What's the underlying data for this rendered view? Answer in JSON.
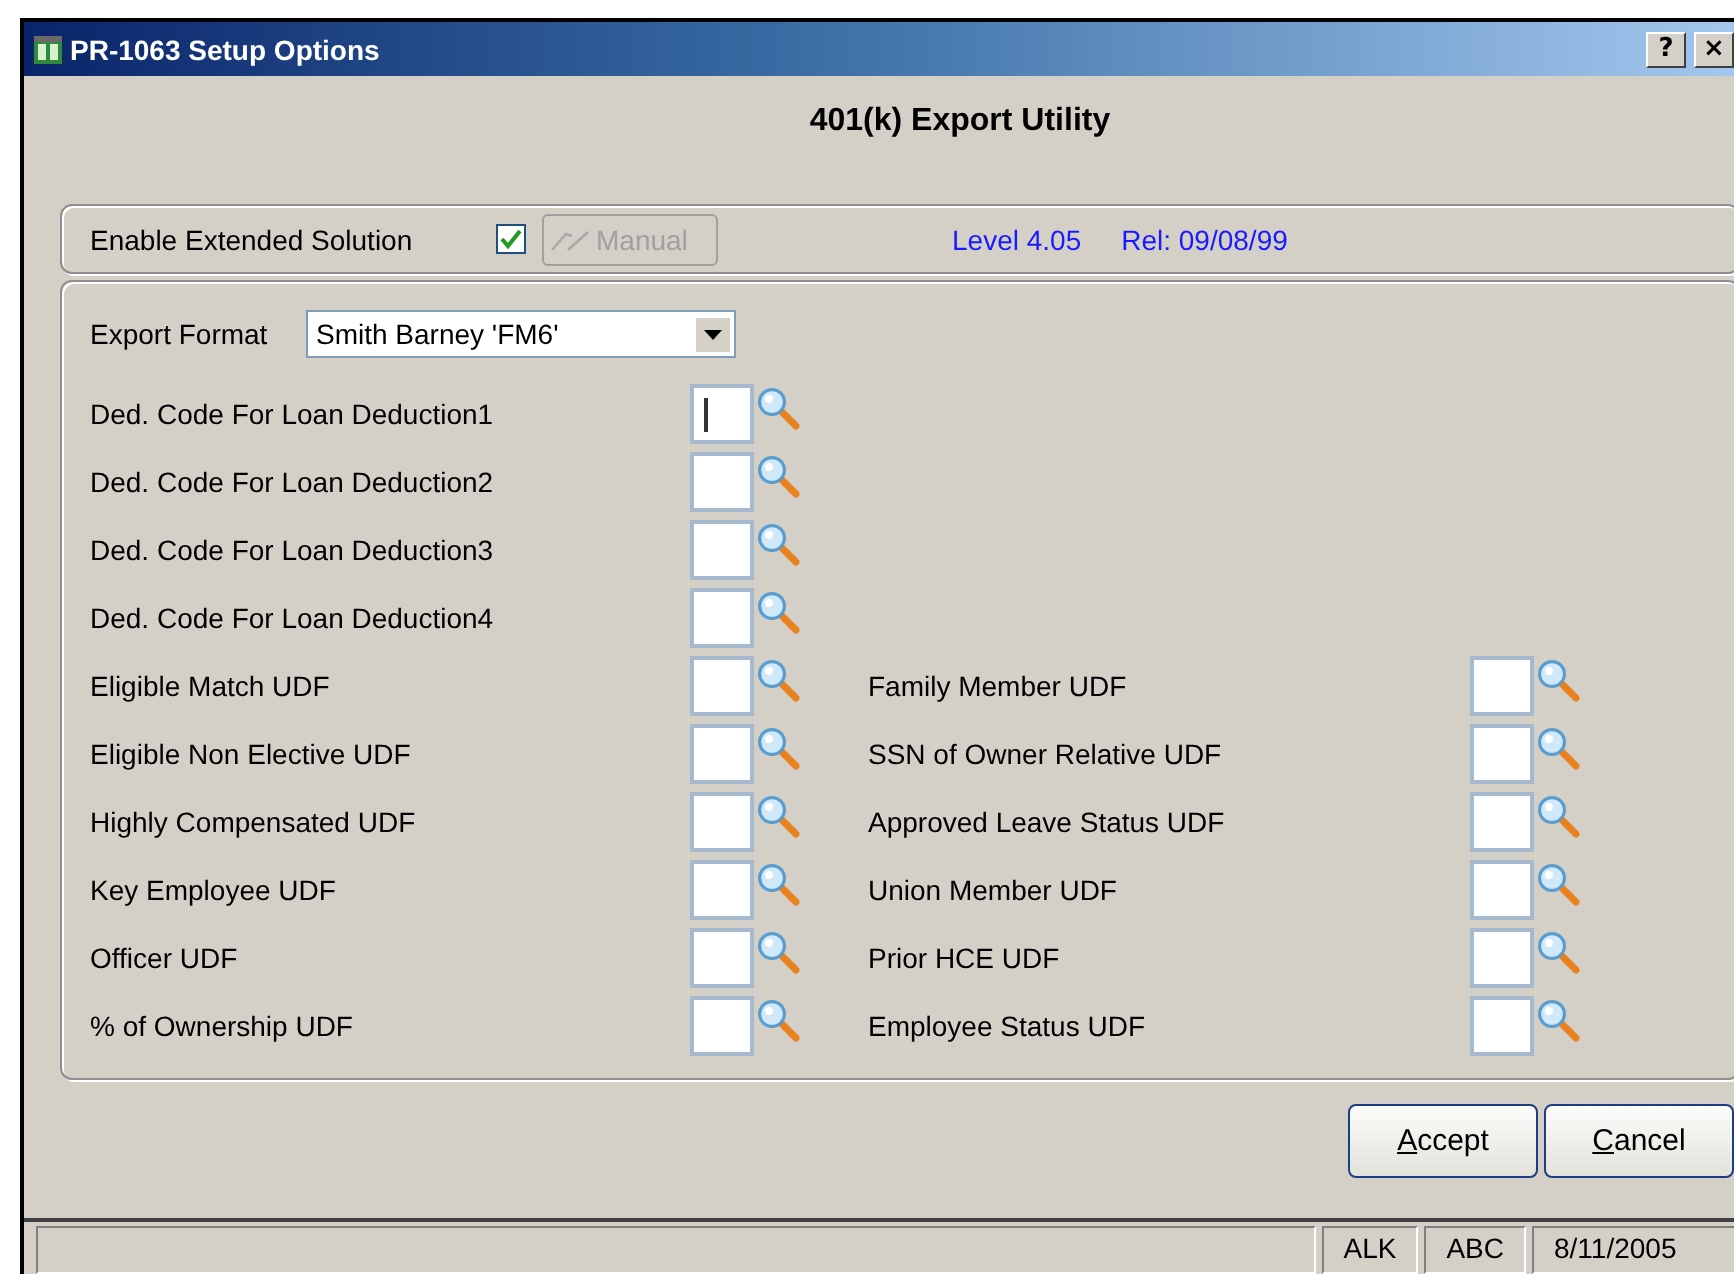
{
  "window": {
    "title": "PR-1063  Setup Options",
    "help_button": "?",
    "close_button": "×"
  },
  "heading": "401(k) Export Utility",
  "solution_panel": {
    "label": "Enable Extended Solution",
    "checked": true,
    "manual_button": {
      "label": "Manual",
      "disabled": true
    },
    "level": "Level 4.05",
    "release": "Rel: 09/08/99"
  },
  "export_format": {
    "label": "Export Format",
    "value": "Smith Barney 'FM6'"
  },
  "rows": [
    {
      "left": {
        "label": "Ded. Code For Loan Deduction1",
        "focused": true
      }
    },
    {
      "left": {
        "label": "Ded. Code For Loan Deduction2",
        "focused": false
      }
    },
    {
      "left": {
        "label": "Ded. Code For Loan Deduction3",
        "focused": false
      }
    },
    {
      "left": {
        "label": "Ded. Code For Loan Deduction4",
        "focused": false
      }
    },
    {
      "left": {
        "label": "Eligible Match UDF",
        "focused": false
      },
      "right": {
        "label": "Family Member UDF",
        "focused": false
      }
    },
    {
      "left": {
        "label": "Eligible Non Elective UDF",
        "focused": false
      },
      "right": {
        "label": "SSN of Owner Relative UDF",
        "focused": false
      }
    },
    {
      "left": {
        "label": "Highly Compensated UDF",
        "focused": false
      },
      "right": {
        "label": "Approved Leave Status UDF",
        "focused": false
      }
    },
    {
      "left": {
        "label": "Key Employee UDF",
        "focused": false
      },
      "right": {
        "label": "Union Member UDF",
        "focused": false
      }
    },
    {
      "left": {
        "label": "Officer UDF",
        "focused": false
      },
      "right": {
        "label": "Prior HCE UDF",
        "focused": false
      }
    },
    {
      "left": {
        "label": "% of Ownership UDF",
        "focused": false
      },
      "right": {
        "label": "Employee Status UDF",
        "focused": false
      }
    }
  ],
  "buttons": [
    {
      "label": "Accept"
    },
    {
      "label": "Cancel"
    }
  ],
  "status_bar": [
    "ALK",
    "ABC",
    "8/11/2005"
  ]
}
